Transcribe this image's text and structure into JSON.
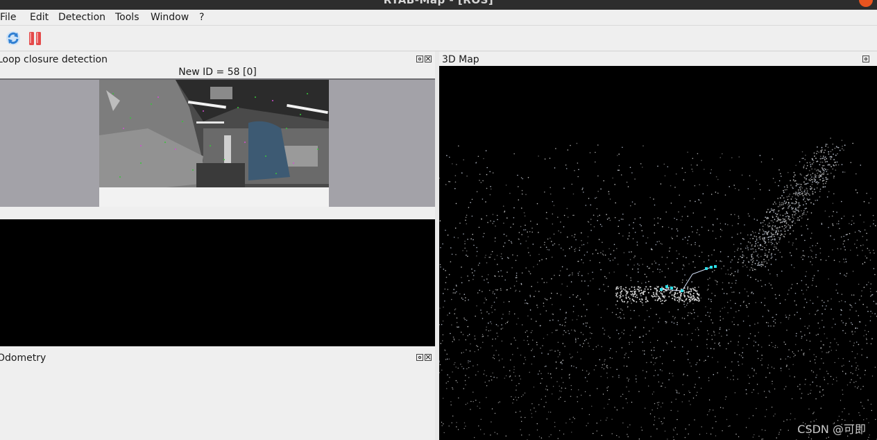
{
  "window": {
    "title": "RTAB-Map - [ROS]"
  },
  "menu": [
    "File",
    "Edit",
    "Detection",
    "Tools",
    "Window",
    "?"
  ],
  "toolbar": {
    "buttons": [
      {
        "icon": "refresh-icon",
        "color": "#3a86d8"
      },
      {
        "icon": "pause-icon",
        "color": "#e03a3a"
      }
    ]
  },
  "loop_closure": {
    "title": "Loop closure detection",
    "label": "New ID = 58 [0]"
  },
  "map3d": {
    "title": "3D Map"
  },
  "odometry": {
    "title": "Odometry"
  },
  "watermark": "CSDN @可即"
}
